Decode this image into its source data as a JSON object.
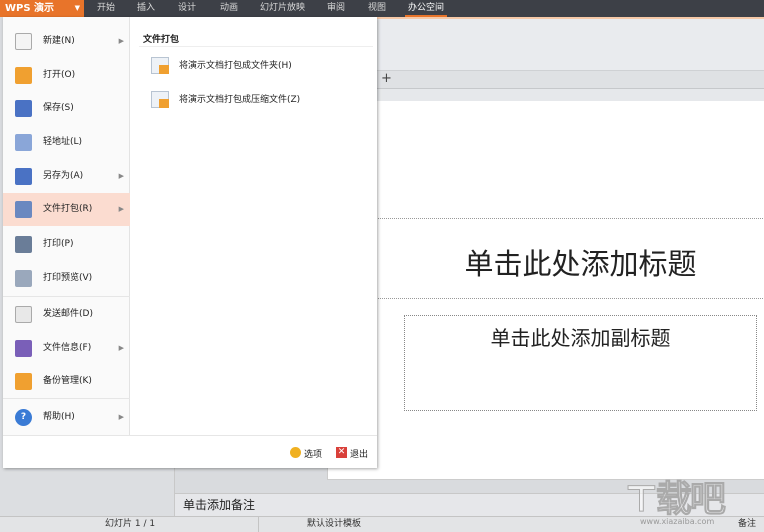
{
  "app": {
    "title": "WPS 演示",
    "dropdown_icon": "caret-down"
  },
  "tabs": [
    {
      "label": "开始"
    },
    {
      "label": "插入"
    },
    {
      "label": "设计"
    },
    {
      "label": "动画"
    },
    {
      "label": "幻灯片放映"
    },
    {
      "label": "审阅"
    },
    {
      "label": "视图"
    },
    {
      "label": "办公空间",
      "active": true
    }
  ],
  "colors": {
    "accent": "#e8742a",
    "topbar": "#3d4047",
    "highlight": "#fbdcd0"
  },
  "menu": {
    "items": [
      {
        "label": "新建(N)",
        "icon": "new-file",
        "submenu": true
      },
      {
        "label": "打开(O)",
        "icon": "open-folder"
      },
      {
        "label": "保存(S)",
        "icon": "save-disk"
      },
      {
        "label": "轻地址(L)",
        "icon": "link"
      },
      {
        "label": "另存为(A)",
        "icon": "save-as",
        "submenu": true
      },
      {
        "label": "文件打包(R)",
        "icon": "package",
        "submenu": true,
        "selected": true
      },
      {
        "label": "打印(P)",
        "icon": "printer"
      },
      {
        "label": "打印预览(V)",
        "icon": "print-preview"
      },
      {
        "label": "发送邮件(D)",
        "icon": "mail"
      },
      {
        "label": "文件信息(F)",
        "icon": "file-info",
        "submenu": true
      },
      {
        "label": "备份管理(K)",
        "icon": "backup"
      },
      {
        "label": "帮助(H)",
        "icon": "help",
        "submenu": true
      }
    ],
    "submenu": {
      "title": "文件打包",
      "items": [
        {
          "label": "将演示文档打包成文件夹(H)"
        },
        {
          "label": "将演示文档打包成压缩文件(Z)"
        }
      ]
    },
    "options_label": "选项",
    "exit_label": "退出"
  },
  "slide": {
    "title_placeholder": "单击此处添加标题",
    "subtitle_placeholder": "单击此处添加副标题"
  },
  "notes_placeholder": "单击添加备注",
  "status": {
    "slide_count": "幻灯片 1 / 1",
    "template": "默认设计模板",
    "notes_label": "备注"
  },
  "watermark": {
    "text": "下载吧",
    "url": "www.xiazaiba.com"
  }
}
